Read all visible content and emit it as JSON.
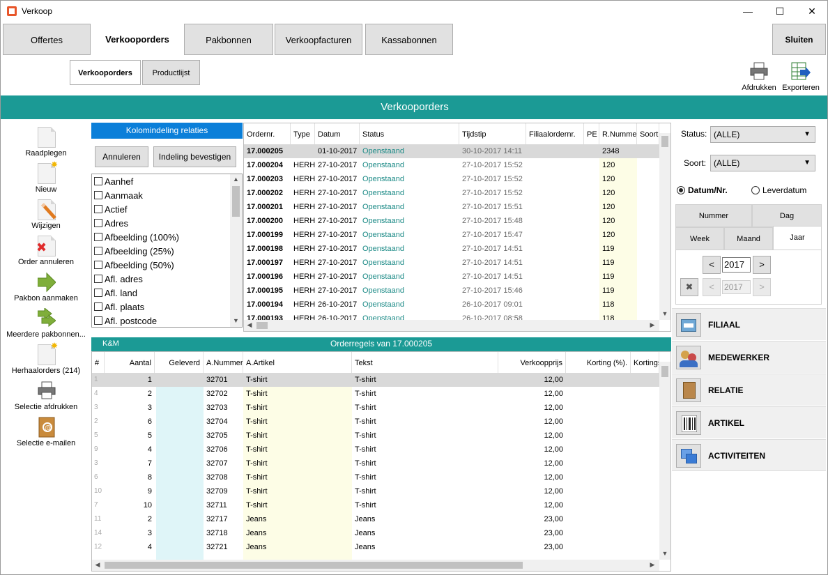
{
  "window": {
    "title": "Verkoop",
    "minimize": "—",
    "maximize": "☐",
    "close": "✕"
  },
  "top_tabs": [
    {
      "label": "Offertes"
    },
    {
      "label": "Verkooporders"
    },
    {
      "label": "Pakbonnen"
    },
    {
      "label": "Verkoopfacturen"
    },
    {
      "label": "Kassabonnen"
    }
  ],
  "close_button": "Sluiten",
  "sub_tabs": [
    {
      "label": "Verkooporders"
    },
    {
      "label": "Productlijst"
    }
  ],
  "tools": {
    "print": "Afdrukken",
    "export": "Exporteren"
  },
  "band_title": "Verkooporders",
  "actions": [
    {
      "label": "Raadplegen"
    },
    {
      "label": "Nieuw"
    },
    {
      "label": "Wijzigen"
    },
    {
      "label": "Order annuleren"
    },
    {
      "label": "Pakbon aanmaken"
    },
    {
      "label": "Meerdere pakbonnen..."
    },
    {
      "label": "Herhaalorders (214)"
    },
    {
      "label": "Selectie afdrukken"
    },
    {
      "label": "Selectie e-mailen"
    }
  ],
  "kolom": {
    "title": "Kolomindeling relaties",
    "cancel": "Annuleren",
    "confirm": "Indeling bevestigen",
    "items": [
      "Aanhef",
      "Aanmaak",
      "Actief",
      "Adres",
      "Afbeelding (100%)",
      "Afbeelding (25%)",
      "Afbeelding (50%)",
      "Afl. adres",
      "Afl. land",
      "Afl. plaats",
      "Afl. postcode"
    ]
  },
  "orders": {
    "columns": [
      "Ordernr.",
      "Type",
      "Datum",
      "Status",
      "Tijdstip",
      "Filiaalordernr.",
      "PE",
      "R.Nummer",
      "Soort"
    ],
    "rows": [
      [
        "17.000205",
        "",
        "01-10-2017",
        "Openstaand",
        "30-10-2017 14:11",
        "",
        "",
        "2348"
      ],
      [
        "17.000204",
        "HERH",
        "27-10-2017",
        "Openstaand",
        "27-10-2017 15:52",
        "",
        "",
        "120"
      ],
      [
        "17.000203",
        "HERH",
        "27-10-2017",
        "Openstaand",
        "27-10-2017 15:52",
        "",
        "",
        "120"
      ],
      [
        "17.000202",
        "HERH",
        "27-10-2017",
        "Openstaand",
        "27-10-2017 15:52",
        "",
        "",
        "120"
      ],
      [
        "17.000201",
        "HERH",
        "27-10-2017",
        "Openstaand",
        "27-10-2017 15:51",
        "",
        "",
        "120"
      ],
      [
        "17.000200",
        "HERH",
        "27-10-2017",
        "Openstaand",
        "27-10-2017 15:48",
        "",
        "",
        "120"
      ],
      [
        "17.000199",
        "HERH",
        "27-10-2017",
        "Openstaand",
        "27-10-2017 15:47",
        "",
        "",
        "120"
      ],
      [
        "17.000198",
        "HERH",
        "27-10-2017",
        "Openstaand",
        "27-10-2017 14:51",
        "",
        "",
        "119"
      ],
      [
        "17.000197",
        "HERH",
        "27-10-2017",
        "Openstaand",
        "27-10-2017 14:51",
        "",
        "",
        "119"
      ],
      [
        "17.000196",
        "HERH",
        "27-10-2017",
        "Openstaand",
        "27-10-2017 14:51",
        "",
        "",
        "119"
      ],
      [
        "17.000195",
        "HERH",
        "27-10-2017",
        "Openstaand",
        "27-10-2017 15:46",
        "",
        "",
        "119"
      ],
      [
        "17.000194",
        "HERH",
        "26-10-2017",
        "Openstaand",
        "26-10-2017 09:01",
        "",
        "",
        "118"
      ],
      [
        "17.000193",
        "HERH",
        "26-10-2017",
        "Openstaand",
        "26-10-2017 08:58",
        "",
        "",
        "118"
      ]
    ]
  },
  "regels": {
    "left_label": "K&M",
    "title": "Orderregels van 17.000205",
    "columns": [
      "#",
      "Aantal",
      "Geleverd",
      "A.Nummer",
      "A.Artikel",
      "Tekst",
      "Verkoopprijs",
      "Korting (%).",
      "Kortings"
    ],
    "rows": [
      [
        "1",
        "1",
        "",
        "32701",
        "T-shirt",
        "T-shirt",
        "12,00"
      ],
      [
        "4",
        "2",
        "",
        "32702",
        "T-shirt",
        "T-shirt",
        "12,00"
      ],
      [
        "3",
        "3",
        "",
        "32703",
        "T-shirt",
        "T-shirt",
        "12,00"
      ],
      [
        "2",
        "6",
        "",
        "32704",
        "T-shirt",
        "T-shirt",
        "12,00"
      ],
      [
        "5",
        "5",
        "",
        "32705",
        "T-shirt",
        "T-shirt",
        "12,00"
      ],
      [
        "9",
        "4",
        "",
        "32706",
        "T-shirt",
        "T-shirt",
        "12,00"
      ],
      [
        "3",
        "7",
        "",
        "32707",
        "T-shirt",
        "T-shirt",
        "12,00"
      ],
      [
        "6",
        "8",
        "",
        "32708",
        "T-shirt",
        "T-shirt",
        "12,00"
      ],
      [
        "10",
        "9",
        "",
        "32709",
        "T-shirt",
        "T-shirt",
        "12,00"
      ],
      [
        "7",
        "10",
        "",
        "32711",
        "T-shirt",
        "T-shirt",
        "12,00"
      ],
      [
        "11",
        "2",
        "",
        "32717",
        "Jeans",
        "Jeans",
        "23,00"
      ],
      [
        "14",
        "3",
        "",
        "32718",
        "Jeans",
        "Jeans",
        "23,00"
      ],
      [
        "12",
        "4",
        "",
        "32721",
        "Jeans",
        "Jeans",
        "23,00"
      ],
      [
        "",
        "",
        "",
        "",
        "",
        "",
        ""
      ]
    ]
  },
  "filters": {
    "status_label": "Status:",
    "status_value": "(ALLE)",
    "soort_label": "Soort:",
    "soort_value": "(ALLE)",
    "radio_datum": "Datum/Nr.",
    "radio_lever": "Leverdatum",
    "period_tabs": [
      "Nummer",
      "Dag",
      "Week",
      "Maand",
      "Jaar"
    ],
    "prev": "<",
    "next": ">",
    "year": "2017",
    "year2": "2017",
    "clear": "✖"
  },
  "nav": [
    {
      "label": "FILIAAL",
      "icon": "store-icon",
      "color": "#6fa8d6"
    },
    {
      "label": "MEDEWERKER",
      "icon": "users-icon",
      "color": "#d4a24c"
    },
    {
      "label": "RELATIE",
      "icon": "address-book-icon",
      "color": "#b9864a"
    },
    {
      "label": "ARTIKEL",
      "icon": "barcode-icon",
      "color": "#444444"
    },
    {
      "label": "ACTIVITEITEN",
      "icon": "windows-icon",
      "color": "#3a7bd5"
    }
  ]
}
